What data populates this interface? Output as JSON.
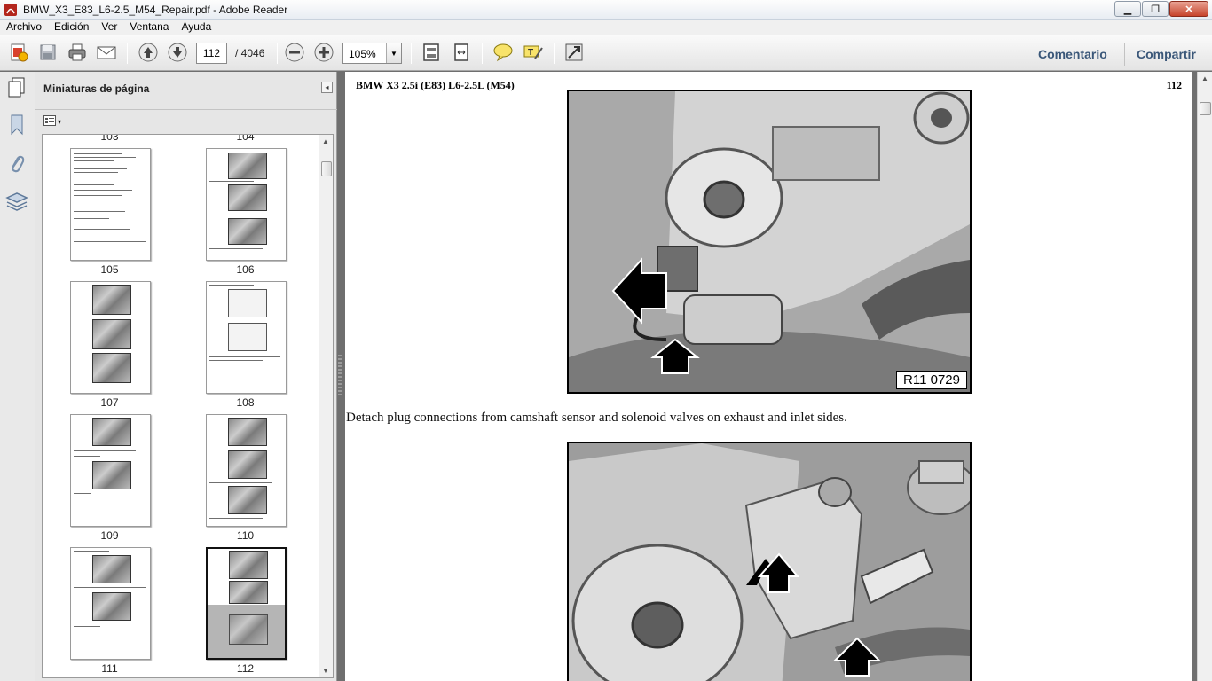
{
  "window": {
    "title": "BMW_X3_E83_L6-2.5_M54_Repair.pdf - Adobe Reader",
    "minimize_glyph": "▁",
    "maximize_glyph": "❐",
    "close_glyph": "✕"
  },
  "menu": [
    "Archivo",
    "Edición",
    "Ver",
    "Ventana",
    "Ayuda"
  ],
  "toolbar": {
    "current_page": "112",
    "total_pages": "/ 4046",
    "zoom": "105%",
    "zoom_dropdown_glyph": "▼",
    "comment_label": "Comentario",
    "share_label": "Compartir",
    "icons": [
      "create-pdf-icon",
      "save-icon",
      "print-icon",
      "email-icon",
      "previous-page-icon",
      "next-page-icon",
      "zoom-out-icon",
      "zoom-in-icon",
      "fit-page-icon",
      "fit-width-icon",
      "comment-icon",
      "highlight-icon",
      "fullscreen-icon"
    ]
  },
  "left_strip": {
    "icons": [
      "page-thumbnails-icon",
      "bookmarks-icon",
      "attachments-icon",
      "layers-icon"
    ]
  },
  "thumbnail_panel": {
    "title": "Miniaturas de página",
    "collapse_glyph": "◂",
    "options_glyph": "▾",
    "scroll_up_glyph": "▲",
    "scroll_down_glyph": "▼",
    "top_labels": [
      "103",
      "104"
    ],
    "pages": [
      "105",
      "106",
      "107",
      "108",
      "109",
      "110",
      "111",
      "112"
    ],
    "selected_page": "112"
  },
  "document": {
    "header_left": "BMW X3 2.5i (E83) L6-2.5L (M54)",
    "header_right": "112",
    "figure1_label": "R11 0729",
    "instruction": "Detach plug connections from camshaft sensor and solenoid valves on exhaust and inlet sides."
  },
  "scrollbar": {
    "up_glyph": "▲"
  }
}
